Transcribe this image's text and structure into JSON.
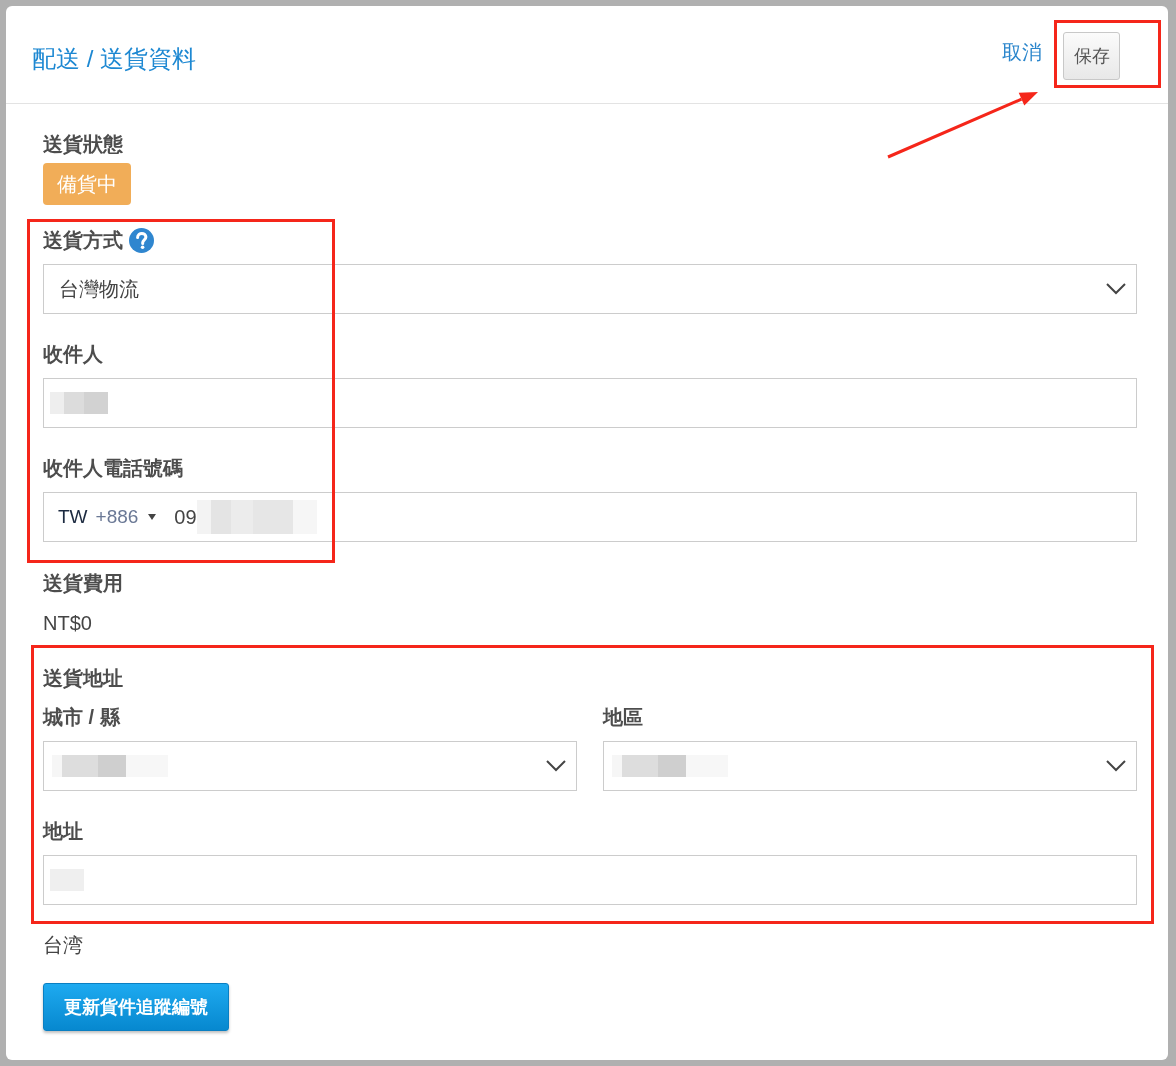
{
  "header": {
    "title": "配送 / 送貨資料",
    "cancel": "取消",
    "save_button": {
      "label": "保存",
      "highlighted": true,
      "arrow": true
    }
  },
  "groups": [
    {
      "highlighted": false,
      "fields": [
        {
          "kind": "status",
          "label": "送貨狀態",
          "badge": "備貨中"
        }
      ]
    },
    {
      "highlighted": true,
      "fields": [
        {
          "kind": "select",
          "label": "送貨方式",
          "help": true,
          "value": "台灣物流"
        },
        {
          "kind": "input",
          "label": "收件人",
          "redacted": true
        },
        {
          "kind": "phone",
          "label": "收件人電話號碼",
          "country": "TW",
          "dial_code": "+886",
          "value": "09",
          "redacted": true
        }
      ]
    },
    {
      "highlighted": false,
      "fields": [
        {
          "kind": "text",
          "label": "送貨費用",
          "value": "NT$0"
        }
      ]
    },
    {
      "highlighted": true,
      "fields": [
        {
          "kind": "heading",
          "label": "送貨地址"
        },
        {
          "kind": "select_pair",
          "items": [
            {
              "label": "城市 / 縣",
              "redacted": true
            },
            {
              "label": "地區",
              "redacted": true
            }
          ]
        },
        {
          "kind": "input",
          "label": "地址",
          "redacted": true
        }
      ]
    },
    {
      "highlighted": false,
      "fields": [
        {
          "kind": "plain",
          "value": "台湾"
        }
      ]
    }
  ],
  "action_button": "更新貨件追蹤編號"
}
